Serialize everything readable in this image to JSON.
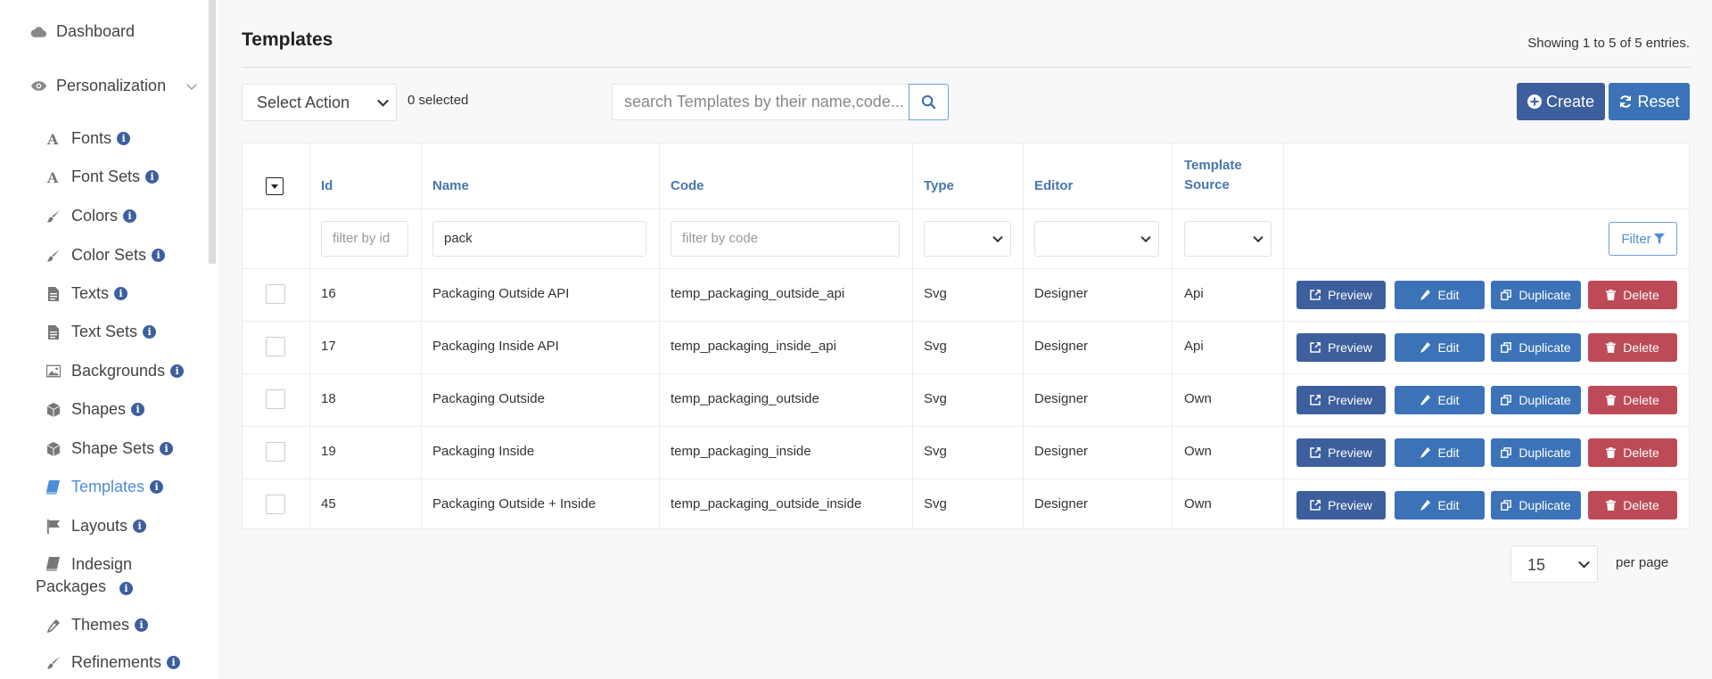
{
  "sidebar": {
    "dashboard": "Dashboard",
    "personalization": "Personalization",
    "items": [
      {
        "label": "Fonts",
        "icon": "font-icon",
        "active": false
      },
      {
        "label": "Font Sets",
        "icon": "font-icon",
        "active": false
      },
      {
        "label": "Colors",
        "icon": "paintbrush-icon",
        "active": false
      },
      {
        "label": "Color Sets",
        "icon": "paintbrush-icon",
        "active": false
      },
      {
        "label": "Texts",
        "icon": "file-text-icon",
        "active": false
      },
      {
        "label": "Text Sets",
        "icon": "file-text-icon",
        "active": false
      },
      {
        "label": "Backgrounds",
        "icon": "image-icon",
        "active": false
      },
      {
        "label": "Shapes",
        "icon": "cube-icon",
        "active": false
      },
      {
        "label": "Shape Sets",
        "icon": "cube-icon",
        "active": false
      },
      {
        "label": "Templates",
        "icon": "book-icon",
        "active": true
      },
      {
        "label": "Layouts",
        "icon": "flag-icon",
        "active": false
      },
      {
        "label": "Indesign",
        "label2": "Packages",
        "icon": "book-icon",
        "active": false
      },
      {
        "label": "Themes",
        "icon": "eyedropper-icon",
        "active": false
      },
      {
        "label": "Refinements",
        "icon": "paintbrush-icon",
        "active": false
      }
    ],
    "info_glyph": "i"
  },
  "header": {
    "title": "Templates",
    "showing": "Showing 1 to 5 of 5 entries."
  },
  "toolbar": {
    "select_action": "Select Action",
    "selected": "0 selected",
    "search_placeholder": "search Templates by their name,code...",
    "create": "Create",
    "reset": "Reset"
  },
  "table": {
    "headers": {
      "id": "Id",
      "name": "Name",
      "code": "Code",
      "type": "Type",
      "editor": "Editor",
      "source1": "Template",
      "source2": "Source"
    },
    "filters": {
      "id": "filter by id",
      "name": "pack",
      "code": "filter by code",
      "button": "Filter"
    },
    "rows": [
      {
        "id": "16",
        "name": "Packaging Outside API",
        "code": "temp_packaging_outside_api",
        "type": "Svg",
        "editor": "Designer",
        "source": "Api"
      },
      {
        "id": "17",
        "name": "Packaging Inside API",
        "code": "temp_packaging_inside_api",
        "type": "Svg",
        "editor": "Designer",
        "source": "Api"
      },
      {
        "id": "18",
        "name": "Packaging Outside",
        "code": "temp_packaging_outside",
        "type": "Svg",
        "editor": "Designer",
        "source": "Own"
      },
      {
        "id": "19",
        "name": "Packaging Inside",
        "code": "temp_packaging_inside",
        "type": "Svg",
        "editor": "Designer",
        "source": "Own"
      },
      {
        "id": "45",
        "name": "Packaging Outside + Inside",
        "code": "temp_packaging_outside_inside",
        "type": "Svg",
        "editor": "Designer",
        "source": "Own"
      }
    ],
    "actions": {
      "preview": "Preview",
      "edit": "Edit",
      "duplicate": "Duplicate",
      "delete": "Delete"
    }
  },
  "pagination": {
    "per_page_value": "15",
    "per_page_label": "per page"
  },
  "colors": {
    "primary": "#3d5f9e",
    "info": "#3c73b8",
    "danger": "#bd4b57",
    "accent": "#4c8ed8"
  }
}
